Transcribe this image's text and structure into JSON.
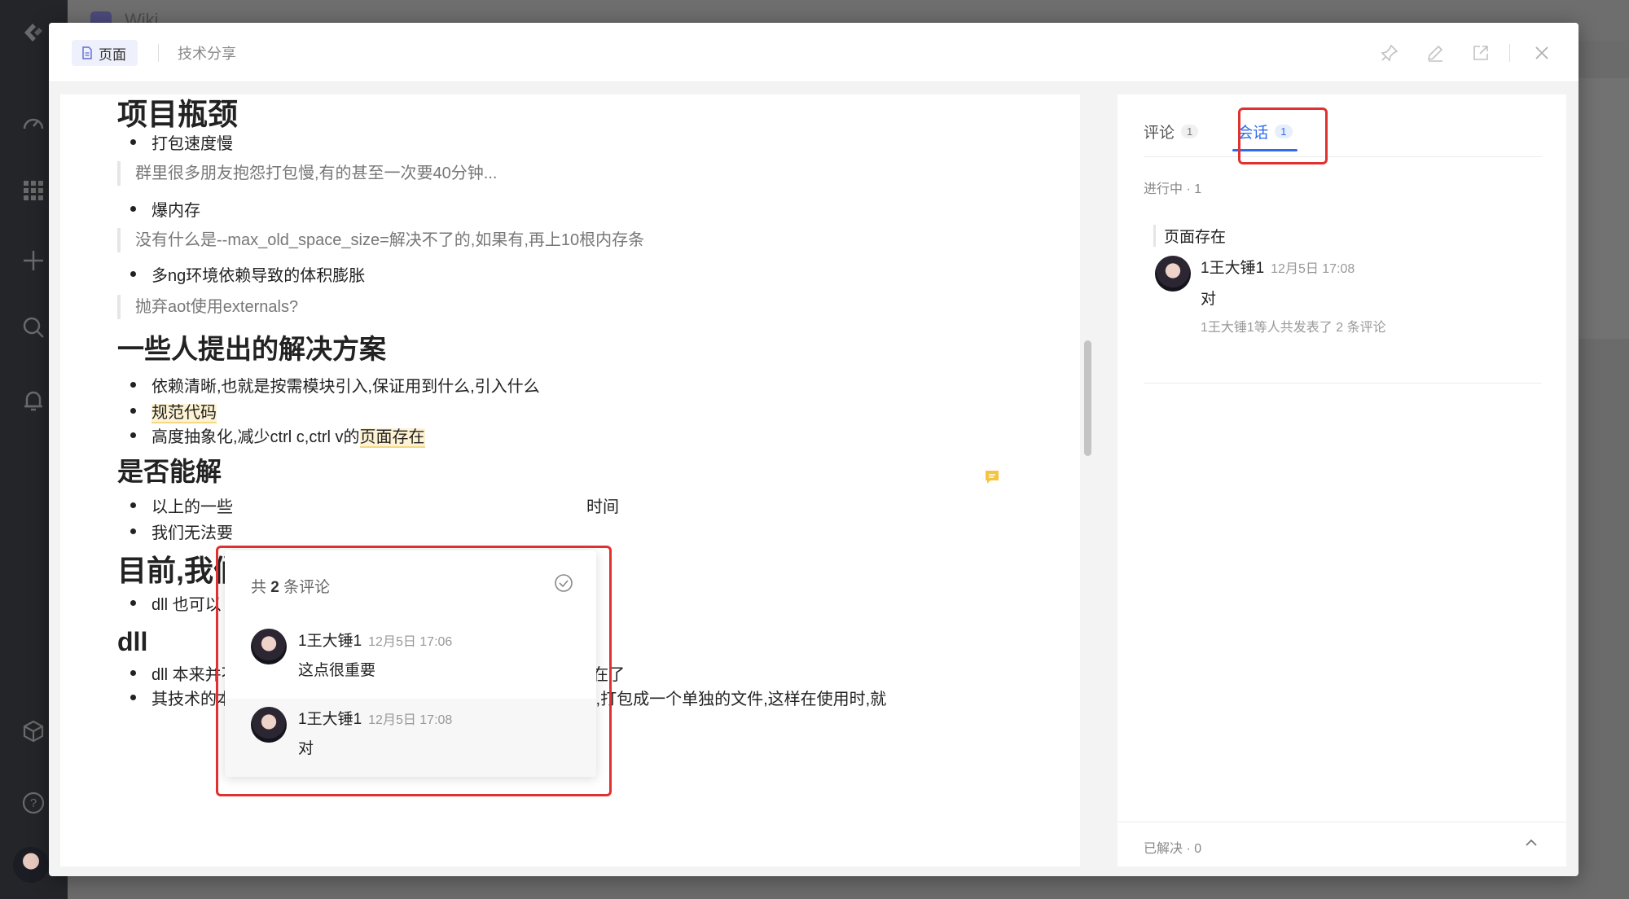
{
  "colors": {
    "accent": "#2f6bef",
    "highlight_border": "#e03131",
    "comment_marker": "#f5c542"
  },
  "background_app": {
    "title": "Wiki"
  },
  "header": {
    "page_tab_label": "页面",
    "breadcrumb": "技术分享",
    "icons": [
      "pin-icon",
      "edit-icon",
      "open-external-icon",
      "close-icon"
    ]
  },
  "document": {
    "h_bottleneck": "项目瓶颈",
    "b1": "打包速度慢",
    "q1": "群里很多朋友抱怨打包慢,有的甚至一次要40分钟...",
    "b2": "爆内存",
    "q2": "没有什么是--max_old_space_size=解决不了的,如果有,再上10根内存条",
    "b3": "多ng环境依赖导致的体积膨胀",
    "q3": "抛弃aot使用externals?",
    "h_solutions": "一些人提出的解决方案",
    "s1": "依赖清晰,也就是按需模块引入,保证用到什么,引入什么",
    "s2": "规范代码",
    "s3_prefix": "高度抽象化,减少ctrl c,ctrl v的",
    "s3_highlight": "页面存在",
    "h_can_solve": "是否能解",
    "c1_start": "以上的一些",
    "c1_end": "时间",
    "c2_start": "我们无法要",
    "h_current": "目前,我们",
    "d1_start": "dll 也可以",
    "h_dll": "dll",
    "dll1": "dll 本来并不是一个新技术,在webpack最早甚至6年前就已经存在了",
    "dll2": "其技术的本质就是将一些经常使用的包,但是不经常修改的部分,打包成一个单独的文件,这样在使用时,就"
  },
  "popover": {
    "title_prefix": "共 ",
    "title_count": "2",
    "title_suffix": " 条评论",
    "comments": [
      {
        "author": "1王大锤1",
        "time": "12月5日 17:06",
        "body": "这点很重要"
      },
      {
        "author": "1王大锤1",
        "time": "12月5日 17:08",
        "body": "对"
      }
    ]
  },
  "panel": {
    "tabs": [
      {
        "label": "评论",
        "count": "1"
      },
      {
        "label": "会话",
        "count": "1"
      }
    ],
    "in_progress": "进行中 · 1",
    "thread": {
      "quote": "页面存在",
      "author": "1王大锤1",
      "time": "12月5日 17:08",
      "body": "对",
      "summary": "1王大锤1等人共发表了 2 条评论"
    },
    "resolved": "已解决 · 0"
  }
}
